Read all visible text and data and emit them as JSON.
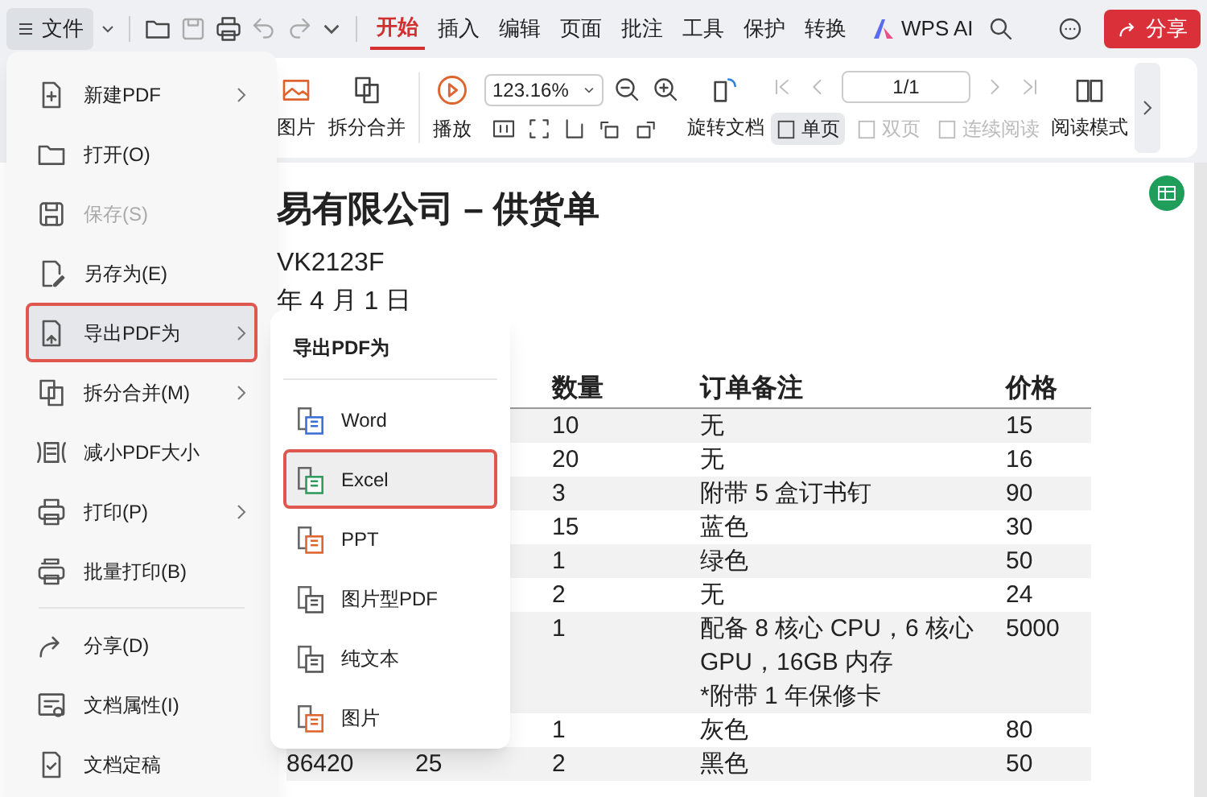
{
  "top_bar": {
    "file_menu": "文件",
    "tabs": [
      {
        "label": "开始",
        "selected": true
      },
      {
        "label": "插入",
        "selected": false
      },
      {
        "label": "编辑",
        "selected": false
      },
      {
        "label": "页面",
        "selected": false
      },
      {
        "label": "批注",
        "selected": false
      },
      {
        "label": "工具",
        "selected": false
      },
      {
        "label": "保护",
        "selected": false
      },
      {
        "label": "转换",
        "selected": false
      }
    ],
    "ai_label": "WPS AI",
    "share_button": "分享"
  },
  "ribbon": {
    "picture_label": "图片",
    "split_merge": "拆分合并",
    "play": "播放",
    "zoom": "123.16%",
    "page": "1/1",
    "rotate": "旋转文档",
    "view_modes": [
      {
        "label": "单页",
        "selected": true,
        "disabled": false
      },
      {
        "label": "双页",
        "selected": false,
        "disabled": true
      },
      {
        "label": "连续阅读",
        "selected": false,
        "disabled": true
      }
    ],
    "reading_mode": "阅读模式"
  },
  "document": {
    "title": "易有限公司 – 供货单",
    "lines": [
      "VK2123F",
      "年 4 月 1 日"
    ],
    "table": {
      "columns": [
        "数量",
        "订单备注",
        "价格"
      ],
      "rows": [
        {
          "qty": "10",
          "note": [
            "无"
          ],
          "price": "15"
        },
        {
          "qty": "20",
          "note": [
            "无"
          ],
          "price": "16"
        },
        {
          "qty": "3",
          "note": [
            "附带 5 盒订书钉"
          ],
          "price": "90"
        },
        {
          "qty": "15",
          "note": [
            "蓝色"
          ],
          "price": "30"
        },
        {
          "qty": "1",
          "note": [
            "绿色"
          ],
          "price": "50"
        },
        {
          "qty": "2",
          "note": [
            "无"
          ],
          "price": "24"
        },
        {
          "qty": "1",
          "note": [
            "配备 8 核心 CPU，6 核心",
            "GPU，16GB 内存",
            "*附带 1 年保修卡"
          ],
          "price": "5000"
        },
        {
          "qty": "1",
          "note": [
            "灰色"
          ],
          "price": "80"
        },
        {
          "column_1": "86420",
          "column_2": "25",
          "qty": "2",
          "note": [
            "黑色"
          ],
          "price": "50"
        }
      ]
    }
  },
  "file_menu": {
    "items": [
      {
        "kind": "new",
        "label": "新建PDF",
        "submenu": true,
        "disabled": false,
        "selected": false
      },
      {
        "kind": "open",
        "label": "打开(O)",
        "submenu": false,
        "disabled": false,
        "selected": false
      },
      {
        "kind": "save",
        "label": "保存(S)",
        "submenu": false,
        "disabled": true,
        "selected": false
      },
      {
        "kind": "saveas",
        "label": "另存为(E)",
        "submenu": false,
        "disabled": false,
        "selected": false
      },
      {
        "kind": "export",
        "label": "导出PDF为",
        "submenu": true,
        "disabled": false,
        "selected": true
      },
      {
        "kind": "split",
        "label": "拆分合并(M)",
        "submenu": true,
        "disabled": false,
        "selected": false
      },
      {
        "kind": "reduce",
        "label": "减小PDF大小",
        "submenu": false,
        "disabled": false,
        "selected": false
      },
      {
        "kind": "print",
        "label": "打印(P)",
        "submenu": true,
        "disabled": false,
        "selected": false
      },
      {
        "kind": "batch",
        "label": "批量打印(B)",
        "submenu": false,
        "disabled": false,
        "selected": false
      },
      {
        "kind": "share",
        "label": "分享(D)",
        "submenu": false,
        "disabled": false,
        "selected": false
      },
      {
        "kind": "props",
        "label": "文档属性(I)",
        "submenu": false,
        "disabled": false,
        "selected": false
      },
      {
        "kind": "final",
        "label": "文档定稿",
        "submenu": false,
        "disabled": false,
        "selected": false
      }
    ]
  },
  "export_submenu": {
    "title": "导出PDF为",
    "items": [
      {
        "label": "Word",
        "color": "#3b6fd6",
        "selected": false
      },
      {
        "label": "Excel",
        "color": "#2e9a5c",
        "selected": true
      },
      {
        "label": "PPT",
        "color": "#e0642e",
        "selected": false
      },
      {
        "label": "图片型PDF",
        "color": "#555555",
        "selected": false
      },
      {
        "label": "纯文本",
        "color": "#555555",
        "selected": false
      },
      {
        "label": "图片",
        "color": "#e0642e",
        "selected": false
      }
    ]
  }
}
